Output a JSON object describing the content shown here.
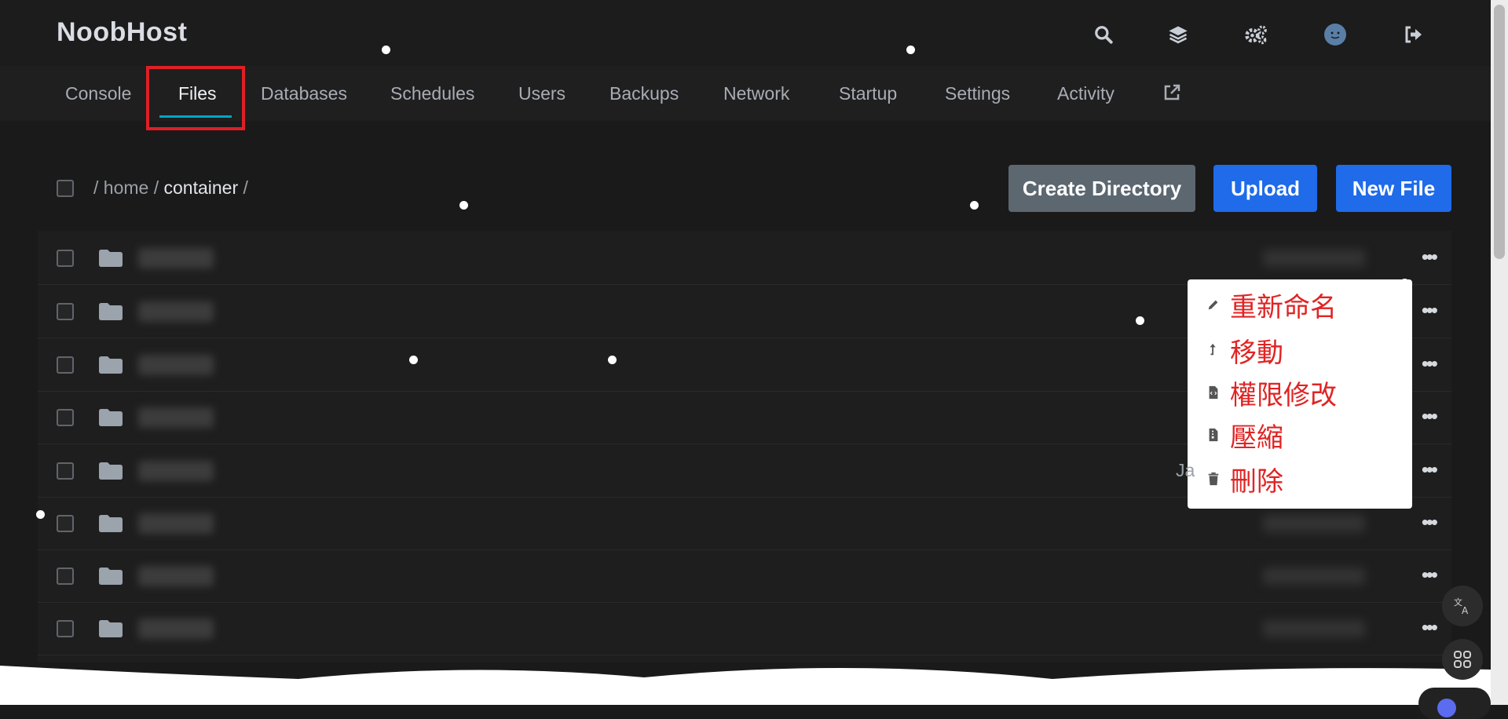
{
  "header": {
    "brand": "NoobHost",
    "icons": [
      "search-icon",
      "layers-icon",
      "gears-icon",
      "avatar",
      "logout-icon"
    ]
  },
  "nav": {
    "tabs": [
      "Console",
      "Files",
      "Databases",
      "Schedules",
      "Users",
      "Backups",
      "Network",
      "Startup",
      "Settings",
      "Activity"
    ],
    "active_tab": "Files",
    "external_icon": "external-link-icon"
  },
  "breadcrumb": {
    "sep": "/",
    "home": "home",
    "current": "container"
  },
  "actions": {
    "create_directory": "Create Directory",
    "upload": "Upload",
    "new_file": "New File"
  },
  "context_menu": {
    "rename": "重新命名",
    "move": "移動",
    "permissions": "權限修改",
    "compress": "壓縮",
    "delete": "刪除"
  },
  "peek_text": "Ja",
  "colors": {
    "background": "#1a1a1a",
    "accent_underline": "#00a7c4",
    "highlight_box": "#e01e26",
    "primary_button": "#1f6bea",
    "secondary_button": "#5c6770",
    "annotation_text": "#e02424"
  }
}
